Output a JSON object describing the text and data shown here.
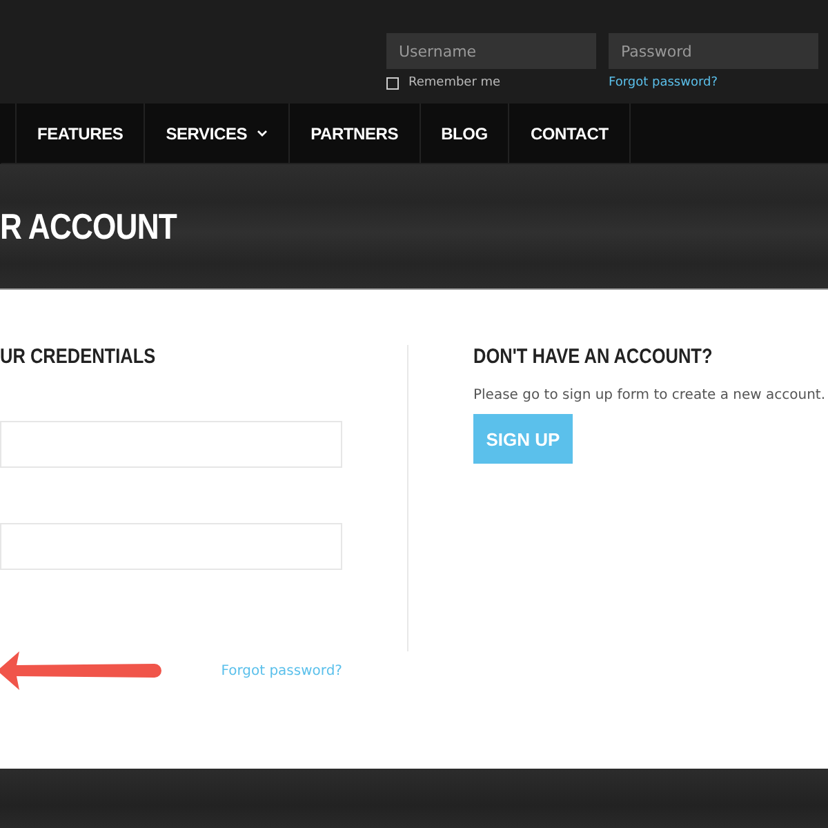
{
  "top_login": {
    "username": {
      "placeholder": "Username"
    },
    "password": {
      "placeholder": "Password"
    },
    "remember": {
      "label": "Remember me",
      "checked": false
    },
    "forgot_link": "Forgot password?"
  },
  "nav": [
    {
      "label": "FEATURES",
      "has_dropdown": false
    },
    {
      "label": "SERVICES",
      "has_dropdown": true
    },
    {
      "label": "PARTNERS",
      "has_dropdown": false
    },
    {
      "label": "BLOG",
      "has_dropdown": false
    },
    {
      "label": "CONTACT",
      "has_dropdown": false
    }
  ],
  "page_title": "R ACCOUNT",
  "login_column": {
    "heading": "UR CREDENTIALS",
    "forgot_link": "Forgot password?"
  },
  "signup_column": {
    "heading": "DON'T HAVE AN ACCOUNT?",
    "text": "Please go to sign up form to create a new account.",
    "button": "SIGN UP"
  }
}
